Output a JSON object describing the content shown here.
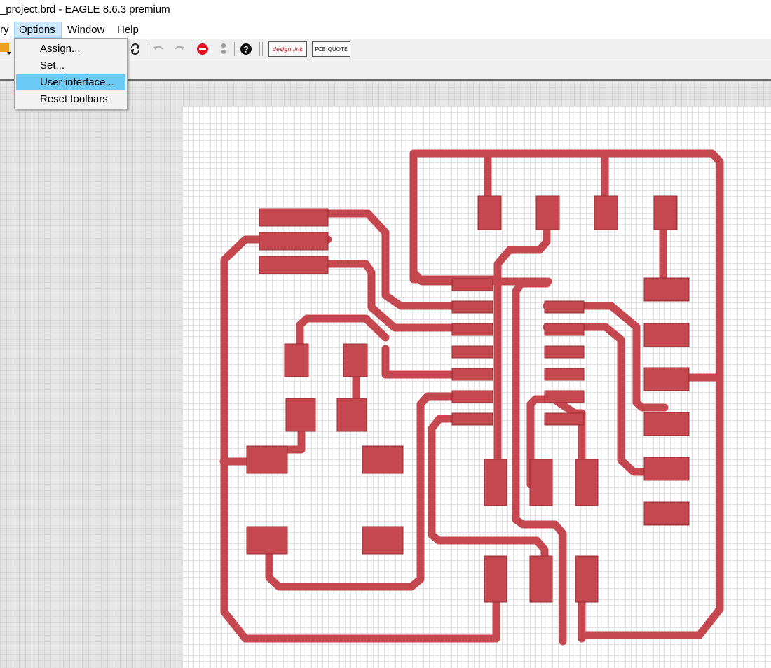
{
  "window": {
    "title": "_project.brd - EAGLE 8.6.3 premium"
  },
  "menubar": {
    "items": [
      {
        "label": "ry"
      },
      {
        "label": "Options"
      },
      {
        "label": "Window"
      },
      {
        "label": "Help"
      }
    ]
  },
  "options_menu": {
    "items": [
      {
        "label": "Assign..."
      },
      {
        "label": "Set..."
      },
      {
        "label": "User interface..."
      },
      {
        "label": "Reset toolbars"
      }
    ],
    "highlighted": "User interface..."
  },
  "toolbar": {
    "icons": [
      "ulp-icon",
      "refresh-icon",
      "undo-icon",
      "redo-icon",
      "stop-icon",
      "go-icon",
      "help-icon"
    ],
    "design_link_label": "design link",
    "pcb_quote_label": "PCB QUOTE"
  },
  "colors": {
    "trace": "#c5474f",
    "trace_stroke": "#9a2d35",
    "pad_text": "#b8864a",
    "menu_highlight": "#6dcaf5",
    "menu_active_bg": "#cce8ff",
    "stop_red": "#e01020"
  }
}
